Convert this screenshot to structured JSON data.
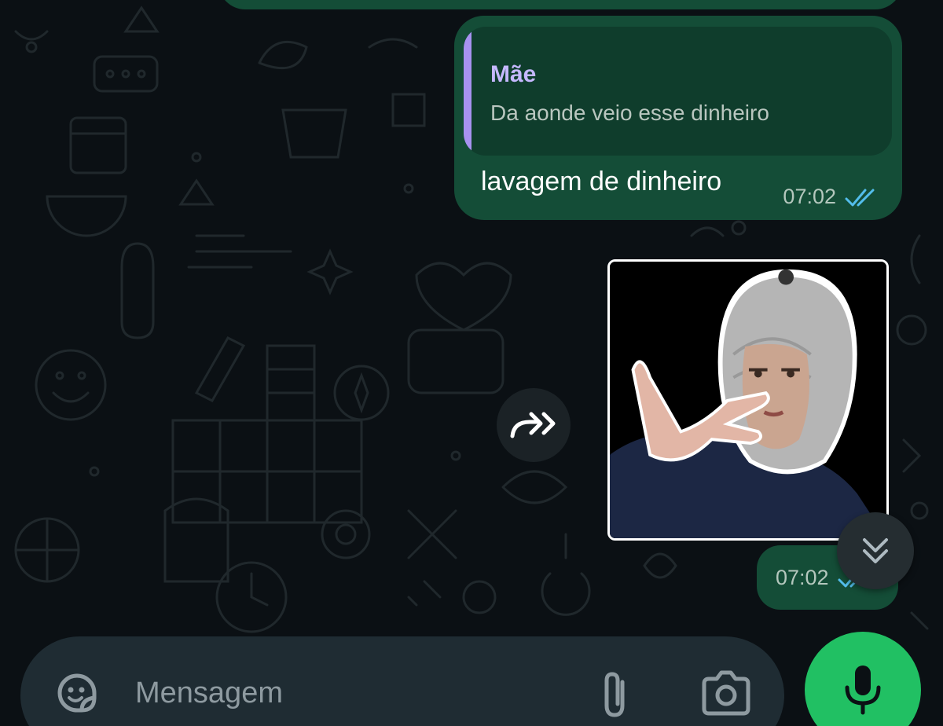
{
  "colors": {
    "background": "#0b1014",
    "outgoing_bubble": "#144d37",
    "quote_bar": "#a792f0",
    "quote_author": "#c5b8ff",
    "read_ticks": "#53bdeb",
    "mic_button": "#21c063",
    "composer": "#1f2c33"
  },
  "messages": [
    {
      "type": "text_reply",
      "direction": "outgoing",
      "quoted": {
        "author": "Mãe",
        "text": "Da aonde veio esse dinheiro"
      },
      "text": "lavagem de dinheiro",
      "time": "07:02",
      "status": "read"
    },
    {
      "type": "sticker",
      "direction": "outgoing",
      "sticker_alt": "sticker",
      "time": "07:02",
      "status": "read"
    }
  ],
  "controls": {
    "forward_icon": "forward-icon",
    "scroll_down_icon": "double-chevron-down-icon"
  },
  "composer": {
    "placeholder": "Mensagem",
    "value": "",
    "sticker_icon": "sticker-icon",
    "attach_icon": "paperclip-icon",
    "camera_icon": "camera-icon",
    "mic_icon": "mic-icon"
  }
}
